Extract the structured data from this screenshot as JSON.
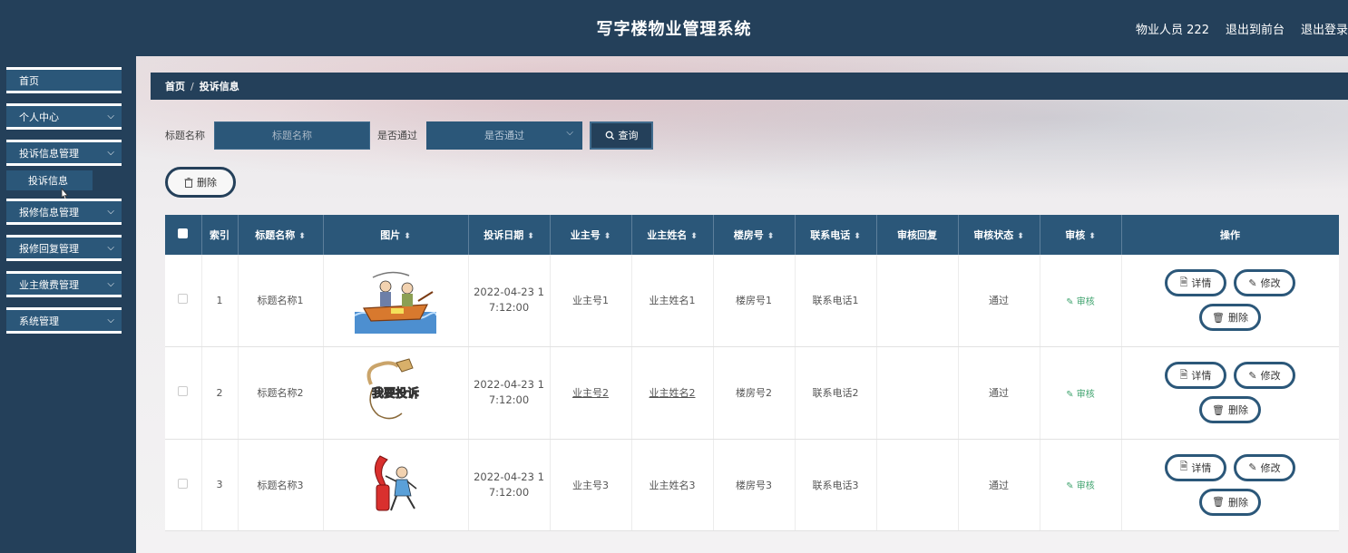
{
  "header": {
    "title": "写字楼物业管理系统",
    "user": "物业人员 222",
    "back_to_front": "退出到前台",
    "logout": "退出登录"
  },
  "sidebar": {
    "items": [
      {
        "label": "首页"
      },
      {
        "label": "个人中心"
      },
      {
        "label": "投诉信息管理"
      },
      {
        "label": "报修信息管理"
      },
      {
        "label": "报修回复管理"
      },
      {
        "label": "业主缴费管理"
      },
      {
        "label": "系统管理"
      }
    ],
    "submenu": {
      "label": "投诉信息"
    }
  },
  "breadcrumb": {
    "home": "首页",
    "separator": "/",
    "current": "投诉信息"
  },
  "search": {
    "title_label": "标题名称",
    "title_placeholder": "标题名称",
    "passed_label": "是否通过",
    "passed_placeholder": "是否通过",
    "query_label": "查询"
  },
  "toolbar": {
    "delete_label": "删除"
  },
  "table": {
    "headers": [
      "索引",
      "标题名称",
      "图片",
      "投诉日期",
      "业主号",
      "业主姓名",
      "楼房号",
      "联系电话",
      "审核回复",
      "审核状态",
      "审核",
      "操作"
    ],
    "rows": [
      {
        "index": "1",
        "title": "标题名称1",
        "date_line1": "2022-04-23 1",
        "date_line2": "7:12:00",
        "owner_no": "业主号1",
        "owner_name": "业主姓名1",
        "building": "楼房号1",
        "phone": "联系电话1",
        "reply": "",
        "status": "通过",
        "audit": "审核"
      },
      {
        "index": "2",
        "title": "标题名称2",
        "date_line1": "2022-04-23 1",
        "date_line2": "7:12:00",
        "owner_no": "业主号2",
        "owner_name": "业主姓名2",
        "building": "楼房号2",
        "phone": "联系电话2",
        "reply": "",
        "status": "通过",
        "audit": "审核"
      },
      {
        "index": "3",
        "title": "标题名称3",
        "date_line1": "2022-04-23 1",
        "date_line2": "7:12:00",
        "owner_no": "业主号3",
        "owner_name": "业主姓名3",
        "building": "楼房号3",
        "phone": "联系电话3",
        "reply": "",
        "status": "通过",
        "audit": "审核"
      }
    ],
    "row_actions": {
      "detail": "详情",
      "edit": "修改",
      "delete": "删除"
    },
    "image_text": {
      "row2": "我要投诉"
    }
  }
}
